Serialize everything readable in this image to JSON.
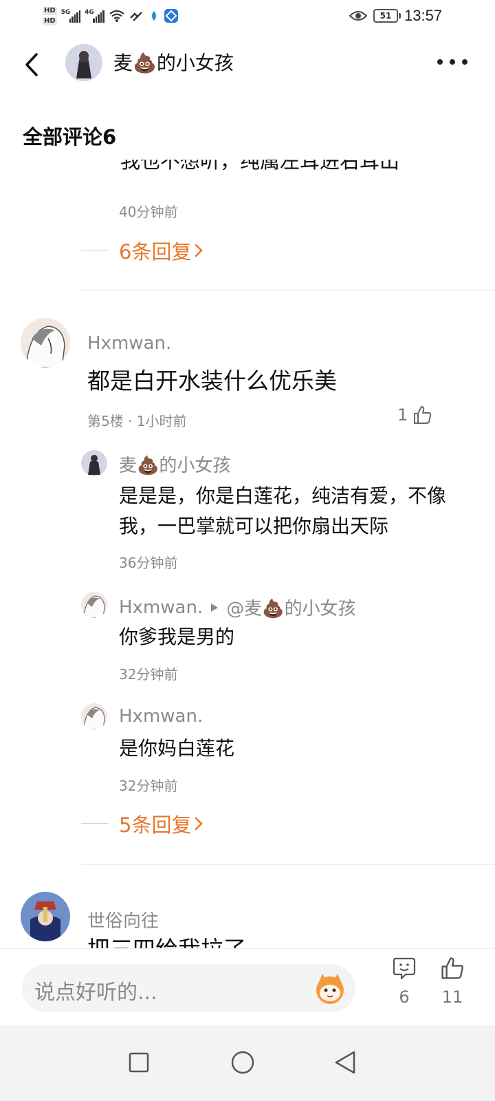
{
  "status_bar": {
    "hd1": "HD",
    "hd2": "HD",
    "net1": "5G",
    "net2": "4G",
    "battery": "51",
    "time": "13:57"
  },
  "header": {
    "name": "麦💩的小女孩",
    "more_icon": "more-icon"
  },
  "comments_title": "全部评论6",
  "top_comment": {
    "partial_text": "我也不想听，纯属左耳进右耳出",
    "time": "40分钟前",
    "replies_label": "6条回复"
  },
  "comment_5": {
    "user": "Hxmwan.",
    "text": "都是白开水装什么优乐美",
    "meta": "第5楼 · 1小时前",
    "likes": "1",
    "replies": [
      {
        "user": "麦💩的小女孩",
        "text": "是是是，你是白莲花，纯洁有爱，不像我，一巴掌就可以把你扇出天际",
        "time": "36分钟前"
      },
      {
        "user": "Hxmwan.",
        "reply_to": "@麦💩的小女孩",
        "text": "你爹我是男的",
        "time": "32分钟前"
      },
      {
        "user": "Hxmwan.",
        "text": "是你妈白莲花",
        "time": "32分钟前"
      }
    ],
    "replies_label": "5条回复"
  },
  "next_comment": {
    "user": "世俗向往",
    "partial_text": "把三四给我拉了"
  },
  "bottom": {
    "input_placeholder": "说点好听的...",
    "comment_count": "6",
    "like_count": "11"
  },
  "colors": {
    "accent": "#e8772e",
    "secondary_text": "#8a8a8a"
  }
}
